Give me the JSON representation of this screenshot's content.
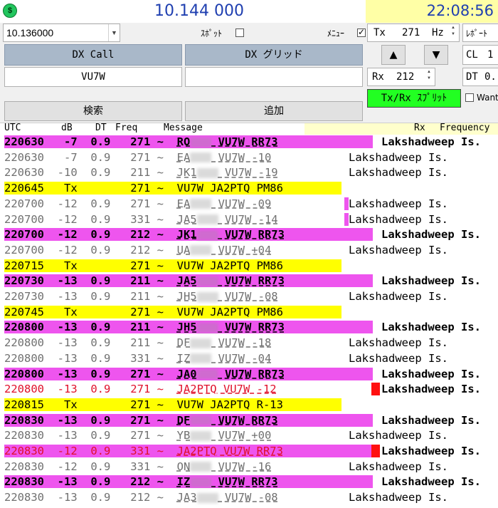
{
  "header": {
    "dial_frequency": "10.144 000",
    "clock": "22:08:56",
    "band_combo": "10.136000",
    "spot_label": "ｽﾎﾟｯﾄ",
    "menu_label": "ﾒﾆｭｰ",
    "tx_label": "Tx",
    "tx_freq": "271",
    "tx_unit": "Hz",
    "report_label": "ﾚﾎﾟｰﾄ",
    "rx_label": "Rx",
    "rx_freq": "212",
    "cl_label": "CL",
    "cl_value": "1",
    "dt_label": "DT",
    "dt_value": "0.",
    "want_label": "Want",
    "up_glyph": "▲",
    "down_glyph": "▼"
  },
  "dx": {
    "call_label": "DX Call",
    "grid_label": "DX グリッド",
    "call_value": "VU7W",
    "grid_value": "",
    "search_label": "検索",
    "add_label": "追加",
    "split_label": "Tx/Rx ｽﾌﾟﾘｯﾄ"
  },
  "columns": {
    "utc": "UTC",
    "db": "dB",
    "dt": "DT",
    "freq": "Freq",
    "message": "Message",
    "rx": "Rx",
    "frequency": "Frequency"
  },
  "colors": {
    "magenta": "#ee55ee",
    "yellow": "#ffff00",
    "green": "#22ff22",
    "red": "#ff1010",
    "blue_text": "#1f3fb0"
  },
  "decodes": [
    {
      "utc": "220630",
      "db": "-7",
      "dt": "0.9",
      "freq": "271",
      "msg_pre": "RO",
      "msg_post": " VU7W RR73",
      "style": "magenta",
      "dx": "Lakshadweep Is.",
      "rx_bold": true
    },
    {
      "utc": "220630",
      "db": "-7",
      "dt": "0.9",
      "freq": "271",
      "msg_pre": "EA",
      "msg_post": " VU7W -10",
      "style": "gray",
      "dx": "Lakshadweep Is."
    },
    {
      "utc": "220630",
      "db": "-10",
      "dt": "0.9",
      "freq": "211",
      "msg_pre": "JK1",
      "msg_post": " VU7W -19",
      "style": "gray",
      "dx": "Lakshadweep Is."
    },
    {
      "utc": "220645",
      "db": "Tx",
      "dt": "",
      "freq": "271",
      "msg_pre": "VU7W JA2PTQ PM86",
      "msg_post": "",
      "style": "yellow",
      "dx": ""
    },
    {
      "utc": "220700",
      "db": "-12",
      "dt": "0.9",
      "freq": "271",
      "msg_pre": "EA",
      "msg_post": " VU7W -09",
      "style": "gray",
      "dx": "Lakshadweep Is.",
      "marker": "magenta"
    },
    {
      "utc": "220700",
      "db": "-12",
      "dt": "0.9",
      "freq": "331",
      "msg_pre": "JA5",
      "msg_post": " VU7W -14",
      "style": "gray",
      "dx": "Lakshadweep Is.",
      "marker": "magenta"
    },
    {
      "utc": "220700",
      "db": "-12",
      "dt": "0.9",
      "freq": "212",
      "msg_pre": "JK1",
      "msg_post": " VU7W RR73",
      "style": "magenta",
      "dx": "Lakshadweep Is."
    },
    {
      "utc": "220700",
      "db": "-12",
      "dt": "0.9",
      "freq": "212",
      "msg_pre": "UA",
      "msg_post": " VU7W +04",
      "style": "gray",
      "dx": "Lakshadweep Is."
    },
    {
      "utc": "220715",
      "db": "Tx",
      "dt": "",
      "freq": "271",
      "msg_pre": "VU7W JA2PTQ PM86",
      "msg_post": "",
      "style": "yellow",
      "dx": ""
    },
    {
      "utc": "220730",
      "db": "-13",
      "dt": "0.9",
      "freq": "211",
      "msg_pre": "JA5",
      "msg_post": " VU7W RR73",
      "style": "magenta",
      "dx": "Lakshadweep Is."
    },
    {
      "utc": "220730",
      "db": "-13",
      "dt": "0.9",
      "freq": "211",
      "msg_pre": "JH5",
      "msg_post": " VU7W -08",
      "style": "gray",
      "dx": "Lakshadweep Is."
    },
    {
      "utc": "220745",
      "db": "Tx",
      "dt": "",
      "freq": "271",
      "msg_pre": "VU7W JA2PTQ PM86",
      "msg_post": "",
      "style": "yellow",
      "dx": ""
    },
    {
      "utc": "220800",
      "db": "-13",
      "dt": "0.9",
      "freq": "211",
      "msg_pre": "JH5",
      "msg_post": " VU7W RR73",
      "style": "magenta",
      "dx": "Lakshadweep Is."
    },
    {
      "utc": "220800",
      "db": "-13",
      "dt": "0.9",
      "freq": "211",
      "msg_pre": "DF",
      "msg_post": " VU7W -18",
      "style": "gray",
      "dx": "Lakshadweep Is."
    },
    {
      "utc": "220800",
      "db": "-13",
      "dt": "0.9",
      "freq": "331",
      "msg_pre": "IZ",
      "msg_post": " VU7W -04",
      "style": "gray",
      "dx": "Lakshadweep Is."
    },
    {
      "utc": "220800",
      "db": "-13",
      "dt": "0.9",
      "freq": "271",
      "msg_pre": "JA0",
      "msg_post": " VU7W RR73",
      "style": "magenta",
      "dx": "Lakshadweep Is."
    },
    {
      "utc": "220800",
      "db": "-13",
      "dt": "0.9",
      "freq": "271",
      "msg_pre": "JA2PTQ VU7W -12",
      "msg_post": "",
      "style": "red",
      "dx": "Lakshadweep Is.",
      "marker": "red"
    },
    {
      "utc": "220815",
      "db": "Tx",
      "dt": "",
      "freq": "271",
      "msg_pre": "VU7W JA2PTQ R-13",
      "msg_post": "",
      "style": "yellow",
      "dx": ""
    },
    {
      "utc": "220830",
      "db": "-13",
      "dt": "0.9",
      "freq": "271",
      "msg_pre": "DF",
      "msg_post": " VU7W RR73",
      "style": "magenta",
      "dx": "Lakshadweep Is."
    },
    {
      "utc": "220830",
      "db": "-13",
      "dt": "0.9",
      "freq": "271",
      "msg_pre": "YB",
      "msg_post": " VU7W +00",
      "style": "gray",
      "dx": "Lakshadweep Is."
    },
    {
      "utc": "220830",
      "db": "-12",
      "dt": "0.9",
      "freq": "331",
      "msg_pre": "JA2PTQ VU7W RR73",
      "msg_post": "",
      "style": "redmag",
      "dx": "Lakshadweep Is.",
      "marker": "red"
    },
    {
      "utc": "220830",
      "db": "-12",
      "dt": "0.9",
      "freq": "331",
      "msg_pre": "ON",
      "msg_post": " VU7W -16",
      "style": "gray",
      "dx": "Lakshadweep Is."
    },
    {
      "utc": "220830",
      "db": "-13",
      "dt": "0.9",
      "freq": "212",
      "msg_pre": "IZ",
      "msg_post": " VU7W RR73",
      "style": "magenta",
      "dx": "Lakshadweep Is."
    },
    {
      "utc": "220830",
      "db": "-13",
      "dt": "0.9",
      "freq": "212",
      "msg_pre": "JA3",
      "msg_post": " VU7W -08",
      "style": "gray",
      "dx": "Lakshadweep Is."
    }
  ]
}
